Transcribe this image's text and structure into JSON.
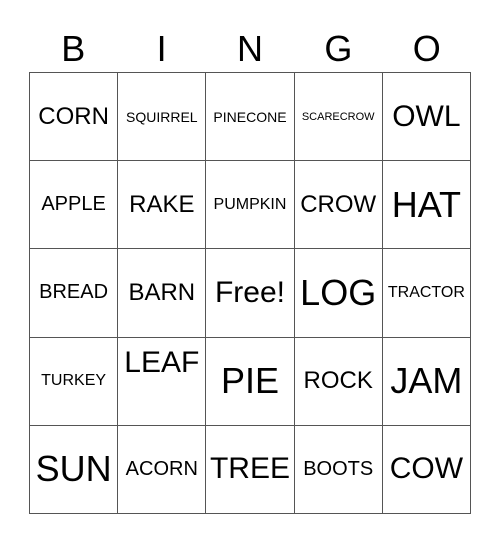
{
  "header": [
    "B",
    "I",
    "N",
    "G",
    "O"
  ],
  "cells": [
    [
      "CORN",
      "SQUIRREL",
      "PINECONE",
      "SCARECROW",
      "OWL"
    ],
    [
      "APPLE",
      "RAKE",
      "PUMPKIN",
      "CROW",
      "HAT"
    ],
    [
      "BREAD",
      "BARN",
      "Free!",
      "LOG",
      "TRACTOR"
    ],
    [
      "TURKEY",
      "LEAF",
      "PIE",
      "ROCK",
      "JAM"
    ],
    [
      "SUN",
      "ACORN",
      "TREE",
      "BOOTS",
      "COW"
    ]
  ]
}
